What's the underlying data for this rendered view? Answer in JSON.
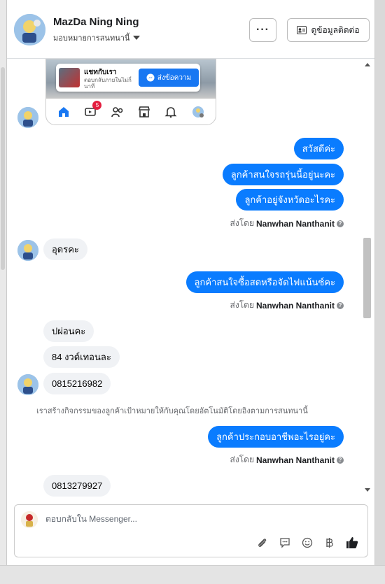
{
  "header": {
    "name": "MazDa Ning Ning",
    "assign_label": "มอบหมายการสนทนานี้",
    "more_label": "···",
    "contact_button": "ดูข้อมูลติดต่อ"
  },
  "preview_card": {
    "chat_title": "แชทกับเรา",
    "chat_sub": "ตอบกลับภายในไม่กี่นาที",
    "send_button": "ส่งข้อความ",
    "notification_count": "5"
  },
  "messages": {
    "out1": "สวัสดีค่ะ",
    "out2": "ลูกค้าสนใจรถรุ่นนี้อยู่นะคะ",
    "out3": "ลูกค้าอยู่จังหวัดอะไรคะ",
    "in1": "อุดรคะ",
    "out4": "ลูกค้าสนใจซื้อสดหรือจัดไฟแน้นซ์คะ",
    "in2": "ปผ่อนคะ",
    "in3": "84 งวด์เทอนละ",
    "in4": "0815216982",
    "system": "เราสร้างกิจกรรมของลูกค้าเป้าหมายให้กับคุณโดยอัตโนมัติโดยอิงตามการสนทนานี้",
    "out5": "ลูกค้าประกอบอาชีพอะไรอยู่คะ",
    "in5": "0813279927"
  },
  "sent_by": {
    "prefix": "ส่งโดย",
    "agent": "Nanwhan Nanthanit",
    "info": "?"
  },
  "composer": {
    "placeholder": "ตอบกลับใน Messenger..."
  },
  "colors": {
    "accent": "#0a7cff",
    "incoming_bg": "#f0f2f5",
    "badge": "#e41e3f"
  }
}
